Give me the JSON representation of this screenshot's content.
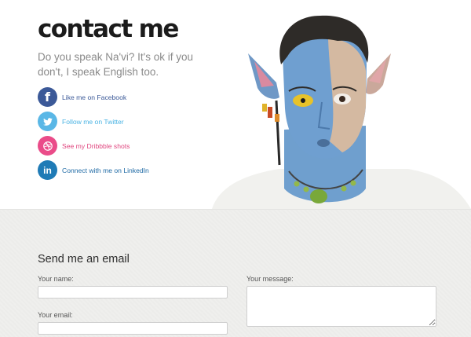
{
  "header": {
    "title": "contact me",
    "intro": "Do you speak Na'vi? It's ok if you don't, I speak English too."
  },
  "social": [
    {
      "label": "Like me on Facebook",
      "icon": "facebook-icon",
      "color": "#3b5998",
      "text_color": "#3b5998"
    },
    {
      "label": "Follow me on Twitter",
      "icon": "twitter-icon",
      "color": "#5ab7e6",
      "text_color": "#4ab3e3"
    },
    {
      "label": "See my Dribbble shots",
      "icon": "dribbble-icon",
      "color": "#ea4c89",
      "text_color": "#e0477f"
    },
    {
      "label": "Connect with me on LinkedIn",
      "icon": "linkedin-icon",
      "color": "#1f7bb6",
      "text_color": "#1f6aa5"
    }
  ],
  "form": {
    "title": "Send me an email",
    "name_label": "Your name:",
    "name_value": "",
    "email_label": "Your email:",
    "email_value": "",
    "message_label": "Your message:",
    "message_value": ""
  }
}
